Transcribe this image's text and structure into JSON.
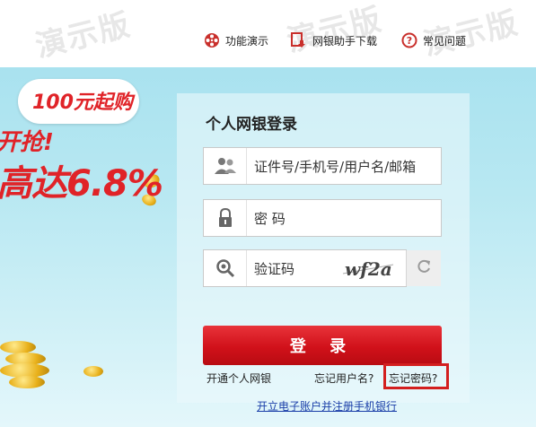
{
  "watermark": "演示版",
  "top_nav": {
    "demo_label": "功能演示",
    "download_label": "网银助手下载",
    "faq_label": "常见问题"
  },
  "promo": {
    "bubble_text": "100元起购",
    "line1": "开抢!",
    "line2": "高达6.8%"
  },
  "login": {
    "title": "个人网银登录",
    "id_placeholder": "证件号/手机号/用户名/邮箱",
    "password_placeholder": "密 码",
    "captcha_placeholder": "验证码",
    "captcha_image_text": "wf2a",
    "login_button": "登 录",
    "open_link": "开通个人网银",
    "forgot_username": "忘记用户名?",
    "forgot_password": "忘记密码?",
    "register_link": "开立电子账户并注册手机银行"
  },
  "colors": {
    "accent": "#d1111a",
    "hero_bg": "#b8e8f2",
    "highlight_border": "#d31f1f",
    "link_blue": "#1a3ea8"
  }
}
